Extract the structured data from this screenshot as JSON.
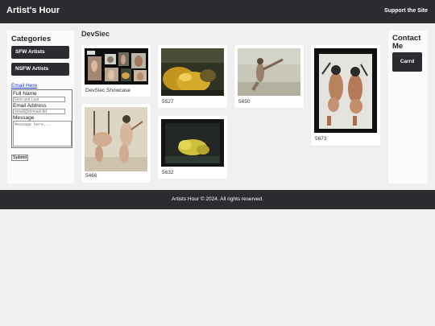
{
  "header": {
    "title": "Artist's Hour",
    "support_link": "Support the Site"
  },
  "sidebar": {
    "heading": "Categories",
    "buttons": [
      {
        "label": "SFW Artists"
      },
      {
        "label": "NSFW Artists"
      }
    ],
    "email_link": "Email Here",
    "form": {
      "name_label": "Full Name",
      "name_placeholder": "First and Last",
      "email_label": "Email Address",
      "email_placeholder": "email@domain.tld",
      "message_label": "Message",
      "message_placeholder": "Message here...",
      "submit_label": "Submit"
    }
  },
  "main": {
    "title": "DevSiec",
    "cards": [
      {
        "label": "DevSiec Showcase"
      },
      {
        "label": "5527"
      },
      {
        "label": "5650"
      },
      {
        "label": "5673"
      },
      {
        "label": "5466"
      },
      {
        "label": "5632"
      }
    ]
  },
  "contact": {
    "heading": "Contact Me",
    "button": "Carrd"
  },
  "footer": {
    "text": "Artists Hour © 2024. All rights reserved."
  }
}
